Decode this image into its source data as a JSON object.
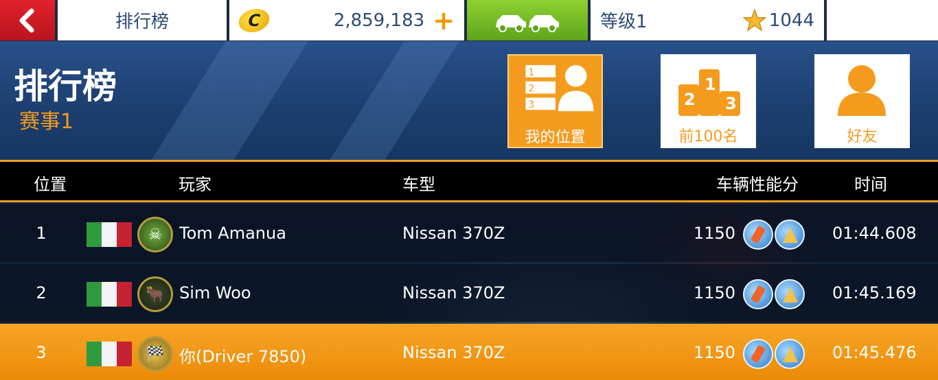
{
  "topbar": {
    "title": "排行榜",
    "coins": "2,859,183",
    "coin_icon_text": "C",
    "level": "等级1",
    "stars": "1044"
  },
  "header": {
    "title": "排行榜",
    "subtitle": "赛事1"
  },
  "tabs": [
    {
      "label": "我的位置",
      "active": true
    },
    {
      "label": "前100名",
      "active": false
    },
    {
      "label": "好友",
      "active": false
    }
  ],
  "columns": {
    "position": "位置",
    "player": "玩家",
    "car": "车型",
    "performance": "车辆性能分",
    "time": "时间"
  },
  "rows": [
    {
      "position": "1",
      "player": "Tom Amanua",
      "car": "Nissan 370Z",
      "score": "1150",
      "time": "01:44.608",
      "avatar": "☠"
    },
    {
      "position": "2",
      "player": "Sim Woo",
      "car": "Nissan 370Z",
      "score": "1150",
      "time": "01:45.169",
      "avatar": "🐂"
    },
    {
      "position": "3",
      "player": "你(Driver 7850)",
      "car": "Nissan 370Z",
      "score": "1150",
      "time": "01:45.476",
      "avatar": "🏁"
    }
  ],
  "colors": {
    "accent_orange": "#f49b1e",
    "back_red": "#d61c25",
    "garage_green": "#76bd25",
    "topbar_text": "#2c4a78"
  }
}
